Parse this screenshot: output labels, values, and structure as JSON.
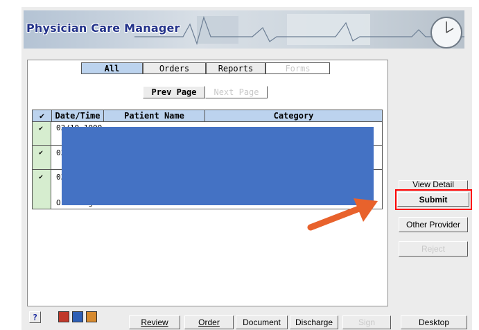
{
  "app": {
    "title": "Physician Care Manager"
  },
  "tabs": [
    {
      "label": "All",
      "state": "active"
    },
    {
      "label": "Orders",
      "state": "normal"
    },
    {
      "label": "Reports",
      "state": "normal"
    },
    {
      "label": "Forms",
      "state": "disabled"
    }
  ],
  "paging": {
    "prev": "Prev Page",
    "next": "Next Page"
  },
  "table": {
    "columns": [
      "✔",
      "Date/Time",
      "Patient Name",
      "Category"
    ],
    "rows": [
      {
        "check": "✔",
        "date": "03/10 1000",
        "fragment": ""
      },
      {
        "check": "✔",
        "date": "03",
        "fragment": ""
      },
      {
        "check": "✔",
        "date": "03",
        "fragment": ""
      }
    ],
    "row3_line": "Ordering Provider"
  },
  "side_buttons": {
    "view_detail": "View Detail",
    "submit": "Submit",
    "other_provider": "Other Provider",
    "reject": "Reject"
  },
  "bottom_buttons": {
    "review": "Review",
    "order": "Order",
    "document": "Document",
    "discharge": "Discharge",
    "sign": "Sign",
    "desktop": "Desktop"
  },
  "help": "?",
  "colors": {
    "highlight": "#ff0000",
    "arrow": "#e8622c",
    "redaction": "#4472c4",
    "header_blue": "#bcd3ee"
  }
}
